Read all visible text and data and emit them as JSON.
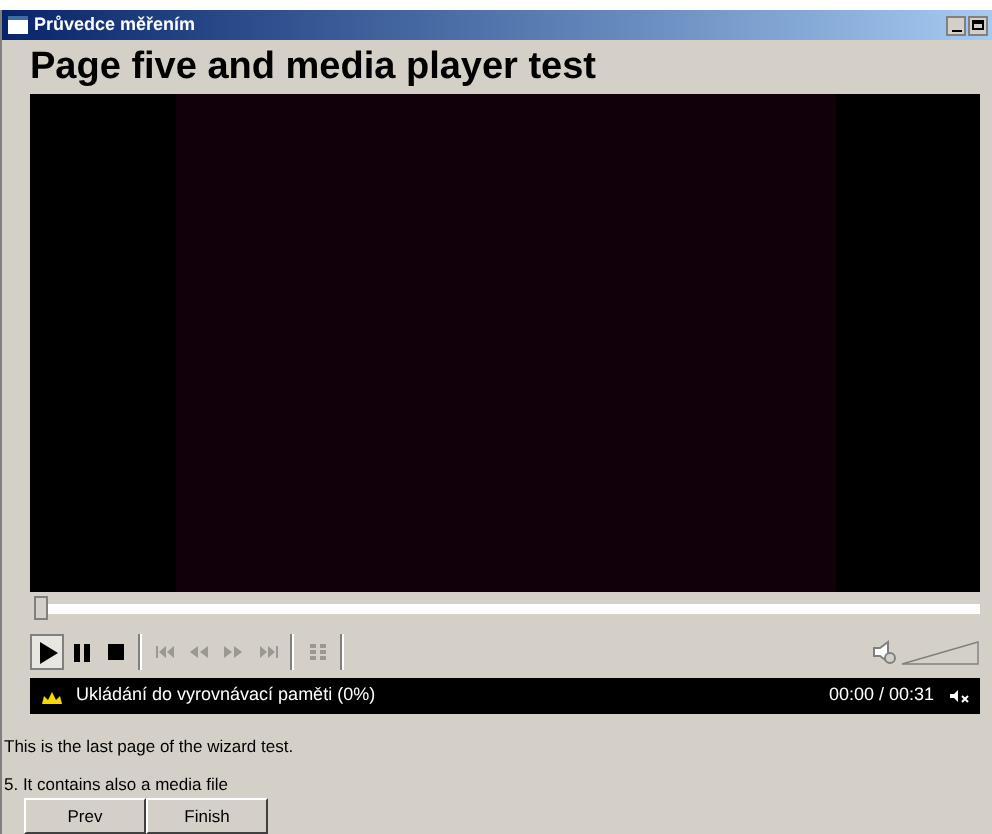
{
  "window": {
    "title": "Průvedce měřením"
  },
  "heading": "Page five and media player test",
  "player": {
    "seek": {
      "level": 0
    },
    "controls": [
      {
        "kind": "play",
        "disabled": false,
        "selected": true
      },
      {
        "kind": "pause",
        "disabled": false,
        "selected": false
      },
      {
        "kind": "stop",
        "disabled": false,
        "selected": false
      },
      {
        "kind": "previous",
        "disabled": true,
        "selected": false
      },
      {
        "kind": "rewind",
        "disabled": true,
        "selected": false
      },
      {
        "kind": "forward",
        "disabled": true,
        "selected": false
      },
      {
        "kind": "next",
        "disabled": true,
        "selected": false
      },
      {
        "kind": "playlist",
        "disabled": true,
        "selected": false
      }
    ],
    "status": "Ukládání do vyrovnávací paměti (0%)",
    "time": "00:00 / 00:31",
    "muted": true
  },
  "description": "This is the last page of the wizard test.",
  "step": "5. It contains also a media file",
  "buttons": [
    "Prev",
    "Finish"
  ]
}
